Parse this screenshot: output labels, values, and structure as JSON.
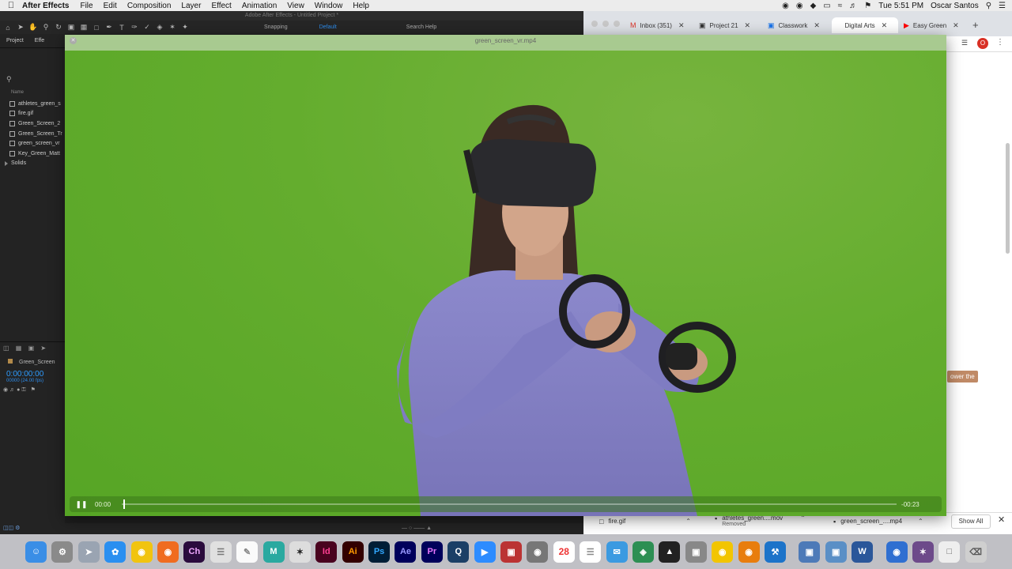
{
  "menubar": {
    "app_name": "After Effects",
    "menus": [
      "File",
      "Edit",
      "Composition",
      "Layer",
      "Effect",
      "Animation",
      "View",
      "Window",
      "Help"
    ],
    "clock": "Tue 5:51 PM",
    "user": "Oscar Santos"
  },
  "ae": {
    "window_title": "Adobe After Effects - Untitled Project *",
    "snapping_label": "Snapping",
    "workspace": "Default",
    "search_help": "Search Help",
    "project_tab": "Project",
    "effects_tab": "Effe",
    "column_name": "Name",
    "files": [
      "athletes_green_s",
      "fire.gif",
      "Green_Screen_2",
      "Green_Screen_Tr",
      "green_screen_vr",
      "Key_Green_Matt",
      "Solids"
    ],
    "comp_tab": "Green_Screen",
    "timecode": "0:00:00:00",
    "fps": "00000 (24.00 fps)"
  },
  "browser": {
    "tabs": [
      {
        "icon": "gmail-icon",
        "title": "Inbox (351)"
      },
      {
        "icon": "classroom-icon",
        "title": "Project 21"
      },
      {
        "icon": "classroom-icon",
        "title": "Classwork"
      },
      {
        "icon": "page-icon",
        "title": "Digital Arts"
      },
      {
        "icon": "youtube-icon",
        "title": "Easy Green"
      }
    ],
    "profile_initial": "O",
    "tooltip": "ower the"
  },
  "player": {
    "title": "green_screen_vr.mp4",
    "current_time": "00:00",
    "remaining_time": "-00:23",
    "progress": 0.0
  },
  "downloads": {
    "items": [
      {
        "name": "fire.gif",
        "sub": ""
      },
      {
        "name": "athletes_green....mov",
        "sub": "Removed"
      },
      {
        "name": "green_screen_....mp4",
        "sub": ""
      }
    ],
    "show_all": "Show All"
  },
  "dock": {
    "apps": [
      "Finder",
      "System Preferences",
      "Launchpad",
      "Safari",
      "Chrome",
      "Firefox",
      "Ch",
      "Notes",
      "TextEdit",
      "M",
      "ZBrush",
      "Id",
      "Ai",
      "Ps",
      "Ae",
      "Pr",
      "QuickTime",
      "Zoom",
      "Photo Booth",
      "Migration",
      "28",
      "Reminders",
      "Mail",
      "Cinema",
      "Unity",
      "Screenshot",
      "Cyberduck",
      "Blender",
      "Xcode",
      "Preview",
      "Image Capture",
      "W",
      "Network",
      "Scrivener",
      "Finder Docs",
      "Trash"
    ],
    "calendar_day": "28"
  }
}
